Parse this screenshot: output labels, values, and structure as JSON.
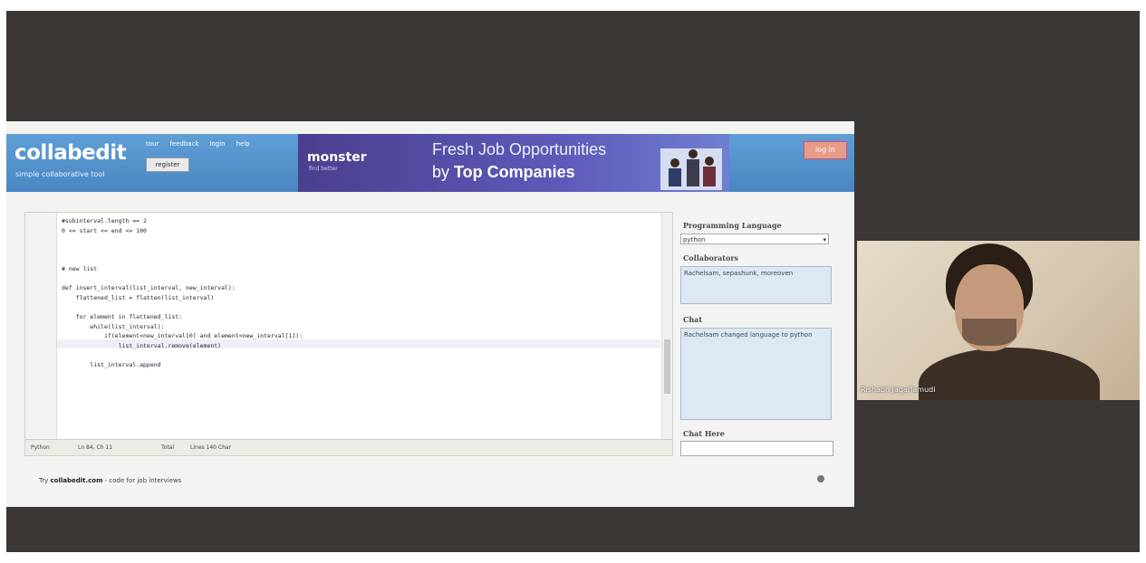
{
  "header": {
    "brand": "collabedit",
    "tagline": "simple collaborative tool",
    "nav_links": [
      "tour",
      "feedback",
      "login",
      "help"
    ],
    "register_button": "register",
    "signin_button": "log in"
  },
  "ad": {
    "logo": "monster",
    "logo_sub": "find better",
    "line1": "Fresh Job Opportunities",
    "line2_prefix": "by ",
    "line2_bold": "Top Companies"
  },
  "editor": {
    "code": "#subinterval.length == 2\n0 <= start <= end <= 100\n\n\n\n# new list\n\ndef insert_interval(list_interval, new_interval):\n    flattened_list = flatten(list_interval)\n\n    for element in flattened_list:\n        while(list_interval):\n            if(element<new_interval[0] and element<new_interval[1]):\n                list_interval.remove(element)\n\n        list_interval.append",
    "status_mode": "Python",
    "status_pos": "Ln 84, Ch 11",
    "status_total": "Total",
    "status_lines": "Lines 140 Char"
  },
  "panel": {
    "language_label": "Programming Language",
    "language_value": "python",
    "collaborators_label": "Collaborators",
    "collaborators_value": "Rachelsam, sepashunk, moreoven",
    "chat_label": "Chat",
    "chat_message": "Rachelsam changed language to python",
    "chat_here_label": "Chat Here"
  },
  "footer": {
    "text_prefix": "Try ",
    "text_bold": "collabedit.com",
    "text_suffix": " - code for job interviews"
  },
  "participant": {
    "name": "Rishabh Jagarlamudi"
  },
  "colors": {
    "header_blue": "#4a86c3",
    "ad_purple": "#5e58b9",
    "panel_box": "#dde8f2",
    "meeting_bg": "#3a3734"
  }
}
